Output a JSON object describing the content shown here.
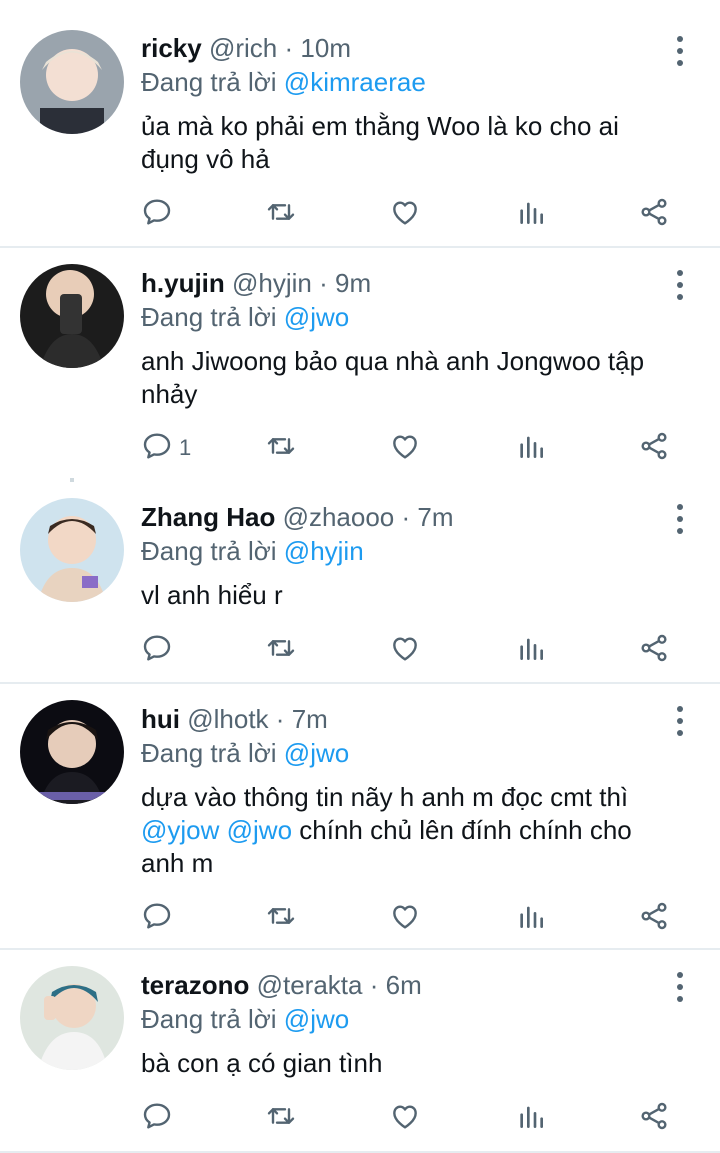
{
  "replying_prefix": "Đang trả lời",
  "tweets": [
    {
      "name": "ricky",
      "handle": "@rich",
      "separator": "·",
      "time": "10m",
      "reply_to": "@kimraerae",
      "text_line1": "ủa mà ko phải em thằng Woo là ko cho ai",
      "text_line2": "đụng vô hả",
      "reply_count": ""
    },
    {
      "name": "h.yujin",
      "handle": "@hyjin",
      "separator": "·",
      "time": "9m",
      "reply_to": "@jwo",
      "text_line1": "anh Jiwoong bảo qua nhà anh Jongwoo tập",
      "text_line2": "nhảy",
      "reply_count": "1"
    },
    {
      "name": "Zhang Hao",
      "handle": "@zhaooo",
      "separator": "·",
      "time": "7m",
      "reply_to": "@hyjin",
      "text_line1": "vl anh hiểu r",
      "reply_count": ""
    },
    {
      "name": "hui",
      "handle": "@lhotk",
      "separator": "·",
      "time": "7m",
      "reply_to": "@jwo",
      "text_line1": "dựa vào thông tin nãy h anh m đọc cmt thì",
      "mention_a": "@yjow",
      "mention_b": "@jwo",
      "text_line2_rest": "chính chủ lên đính chính cho",
      "text_line3": "anh m",
      "reply_count": ""
    },
    {
      "name": "terazono",
      "handle": "@terakta",
      "separator": "·",
      "time": "6m",
      "reply_to": "@jwo",
      "text_line1": "bà con ạ có gian tình",
      "reply_count": ""
    }
  ],
  "icons": {
    "reply": "reply-icon",
    "retweet": "retweet-icon",
    "like": "like-icon",
    "views": "views-icon",
    "share": "share-icon",
    "more": "more-icon"
  },
  "colors": {
    "accent": "#1d9bf0",
    "muted": "#536471",
    "text": "#0f1419",
    "divider": "#e6ecf0"
  }
}
